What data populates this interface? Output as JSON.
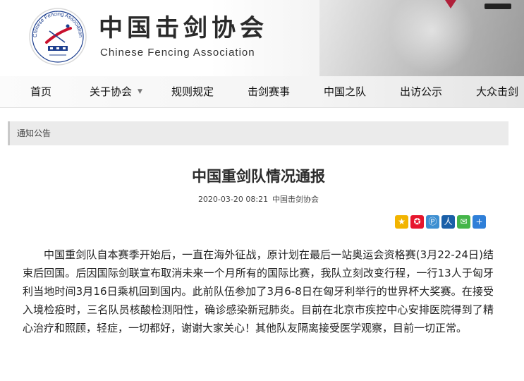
{
  "site": {
    "title_cn": "中国击剑协会",
    "title_en": "Chinese Fencing Association",
    "logo_text": "Chinese Fencing Association"
  },
  "nav": {
    "items": [
      {
        "label": "首页"
      },
      {
        "label": "关于协会",
        "has_dropdown": true
      },
      {
        "label": "规则规定"
      },
      {
        "label": "击剑赛事"
      },
      {
        "label": "中国之队"
      },
      {
        "label": "出访公示"
      },
      {
        "label": "大众击剑"
      }
    ],
    "dropdown_icon": "caret-down-icon"
  },
  "section": {
    "label": "通知公告"
  },
  "article": {
    "title": "中国重剑队情况通报",
    "date": "2020-03-20 08:21",
    "source": "中国击剑协会",
    "body": "中国重剑队自本赛季开始后，一直在海外征战，原计划在最后一站奥运会资格赛(3月22-24日)结束后回国。后因国际剑联宣布取消未来一个月所有的国际比赛，我队立刻改变行程，一行13人于匈牙利当地时间3月16日乘机回到国内。此前队伍参加了3月6-8日在匈牙利举行的世界杯大奖赛。在接受入境检疫时，三名队员核酸检测阳性，确诊感染新冠肺炎。目前在北京市疾控中心安排医院得到了精心治疗和照顾，轻症，一切都好，谢谢大家关心！其他队友隔离接受医学观察，目前一切正常。"
  },
  "share": {
    "icons": [
      {
        "name": "qzone-share-icon",
        "color": "#f2b400",
        "glyph": "★"
      },
      {
        "name": "weibo-share-icon",
        "color": "#e6162d",
        "glyph": "✪"
      },
      {
        "name": "tencent-weibo-share-icon",
        "color": "#3d8fd1",
        "glyph": "Ⓟ"
      },
      {
        "name": "renren-share-icon",
        "color": "#1a5fa8",
        "glyph": "人"
      },
      {
        "name": "wechat-share-icon",
        "color": "#44b549",
        "glyph": "✉"
      },
      {
        "name": "more-share-icon",
        "color": "#2f7fd8",
        "glyph": "+"
      }
    ]
  },
  "colors": {
    "logo_red": "#c8102e",
    "logo_blue": "#1d3f8f",
    "nav_text": "#111111",
    "section_bg": "#ebebeb"
  }
}
